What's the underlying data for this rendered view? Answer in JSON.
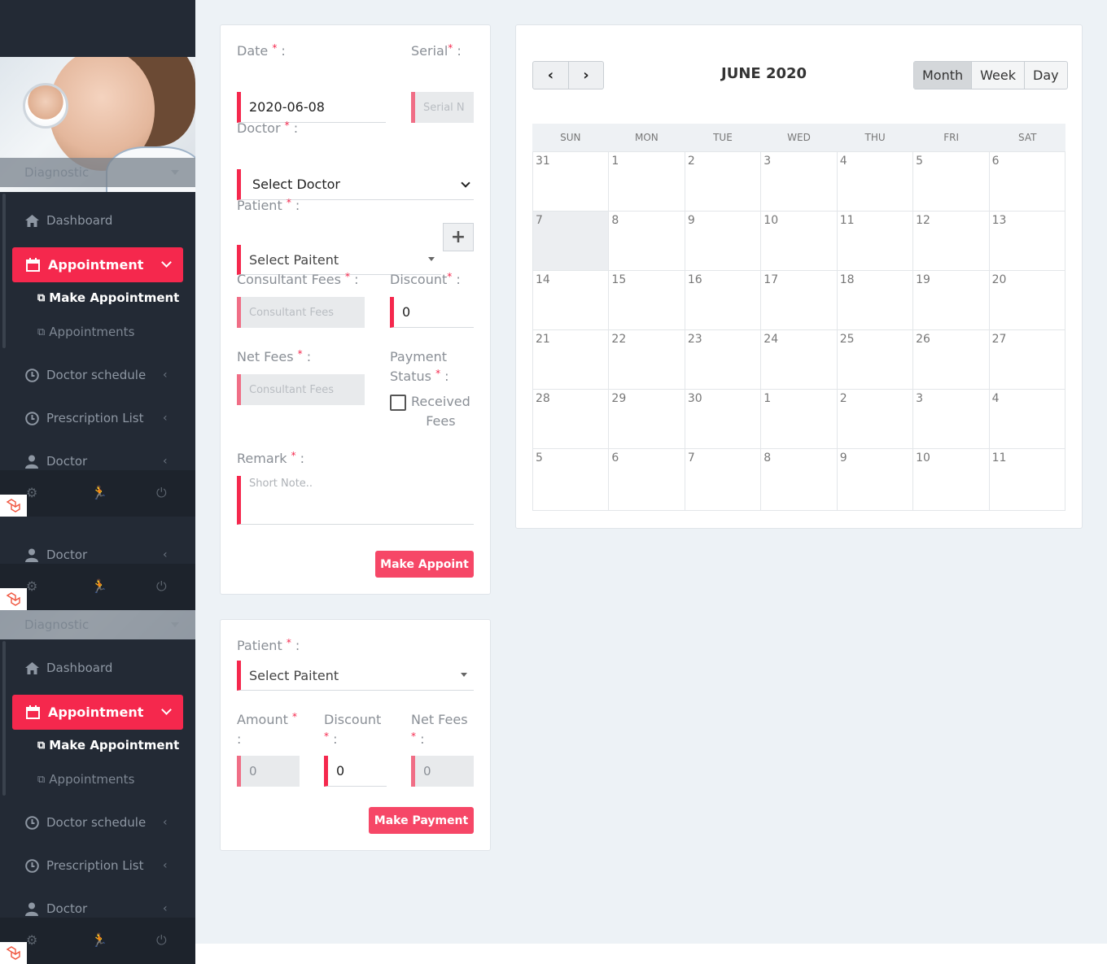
{
  "sidebar": {
    "brand": "Diagnostic",
    "menu": {
      "dashboard": "Dashboard",
      "appointment": "Appointment",
      "make_appointment": "Make Appointment",
      "appointments": "Appointments",
      "doctor_schedule": "Doctor schedule",
      "prescription_list": "Prescription List",
      "doctor": "Doctor"
    }
  },
  "appointment_form": {
    "date_label": "Date",
    "date_value": "2020-06-08",
    "serial_label": "Serial",
    "serial_placeholder": "Serial N",
    "doctor_label": "Doctor",
    "doctor_value": "Select Doctor",
    "patient_label": "Patient",
    "patient_value": "Select Paitent",
    "consultant_fees_label": "Consultant Fees",
    "consultant_fees_placeholder": "Consultant Fees",
    "discount_label": "Discount",
    "discount_value": "0",
    "net_fees_label": "Net Fees",
    "net_fees_placeholder": "Consultant Fees",
    "payment_status_label_1": "Payment",
    "payment_status_label_2": "Status",
    "received_fees_1": "Received",
    "received_fees_2": "Fees",
    "remark_label": "Remark",
    "remark_placeholder": "Short Note..",
    "submit": "Make Appoint"
  },
  "payment_form": {
    "patient_label": "Patient",
    "patient_value": "Select Paitent",
    "amount_label": "Amount",
    "amount_value": "0",
    "discount_label": "Discount",
    "discount_value": "0",
    "net_fees_label": "Net Fees",
    "net_fees_value": "0",
    "submit": "Make Payment"
  },
  "calendar": {
    "title": "JUNE 2020",
    "views": [
      "Month",
      "Week",
      "Day"
    ],
    "active_view": "Month",
    "weekdays": [
      "SUN",
      "MON",
      "TUE",
      "WED",
      "THU",
      "FRI",
      "SAT"
    ],
    "days": [
      "31",
      "1",
      "2",
      "3",
      "4",
      "5",
      "6",
      "7",
      "8",
      "9",
      "10",
      "11",
      "12",
      "13",
      "14",
      "15",
      "16",
      "17",
      "18",
      "19",
      "20",
      "21",
      "22",
      "23",
      "24",
      "25",
      "26",
      "27",
      "28",
      "29",
      "30",
      "1",
      "2",
      "3",
      "4",
      "5",
      "6",
      "7",
      "8",
      "9",
      "10",
      "11"
    ],
    "today_index": 7
  },
  "colors": {
    "accent": "#f5284d",
    "sidebar": "#232a35"
  }
}
